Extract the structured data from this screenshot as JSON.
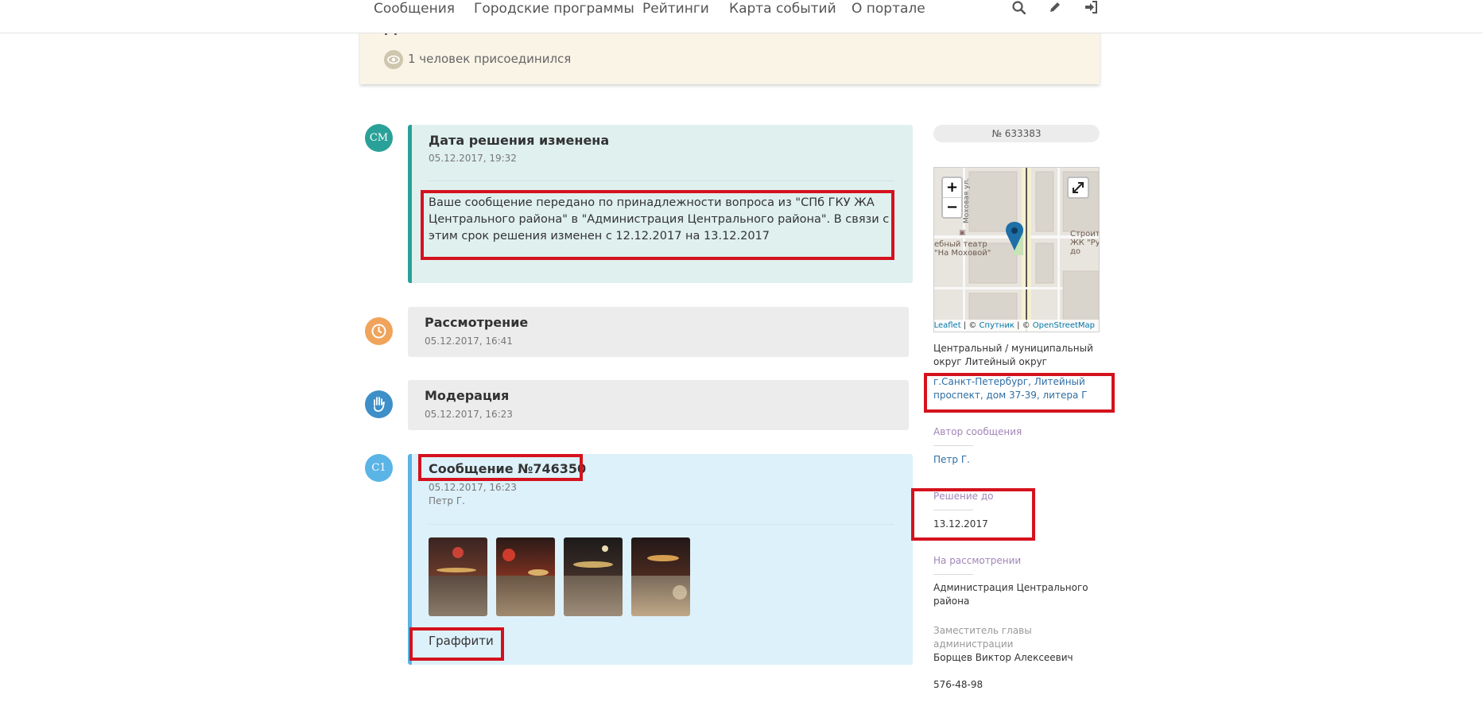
{
  "nav": {
    "items": [
      "Сообщения",
      "Городские программы",
      "Рейтинги",
      "Карта событий",
      "О портале"
    ],
    "icons": [
      "search-icon",
      "pencil-icon",
      "sign-in-icon"
    ]
  },
  "notice": {
    "title_partial": "дела",
    "joined": "1 человек присоединился"
  },
  "timeline": [
    {
      "avatar": "СМ",
      "avatar_color": "#2aa198",
      "title": "Дата решения изменена",
      "date": "05.12.2017, 19:32",
      "text": "Ваше сообщение передано по принадлежности вопроса из \"СПб ГКУ ЖА Центрального района\" в \"Администрация Центрального района\". В связи с этим срок решения изменен с 12.12.2017 на 13.12.2017"
    },
    {
      "avatar_icon": "clock-icon",
      "avatar_color": "#f0a35a",
      "title": "Рассмотрение",
      "date": "05.12.2017, 16:41"
    },
    {
      "avatar_icon": "hand-icon",
      "avatar_color": "#3d8fc8",
      "title": "Модерация",
      "date": "05.12.2017, 16:23"
    },
    {
      "avatar": "С1",
      "avatar_color": "#5ab4e5",
      "title": "Сообщение №746350",
      "date": "05.12.2017, 16:23",
      "author": "Петр Г.",
      "category": "Граффити"
    }
  ],
  "sidebar": {
    "number": "№ 633383",
    "map": {
      "zoom_in": "+",
      "zoom_out": "−",
      "street": "Моховая ул.",
      "poi_left": "ебный театр\n\"На Моховой\"",
      "poi_right": "Строите\nЖК \"Ру\nдо",
      "attribution_leaflet": "Leaflet",
      "attribution_sep1": " | © ",
      "attribution_sputnik": "Спутник",
      "attribution_sep2": " | © ",
      "attribution_osm": "OpenStreetMap"
    },
    "district": "Центральный / муниципальный округ Литейный округ",
    "address": "г.Санкт-Петербург, Литейный проспект, дом 37-39, литера Г",
    "author_label": "Автор сообщения",
    "author_name": "Петр Г.",
    "deadline_label": "Решение до",
    "deadline_value": "13.12.2017",
    "review_label": "На рассмотрении",
    "review_value": "Администрация Центрального района",
    "deputy_label": "Заместитель главы администрации",
    "deputy_name": "Борщев Виктор Алексеевич",
    "phone": "576-48-98"
  }
}
